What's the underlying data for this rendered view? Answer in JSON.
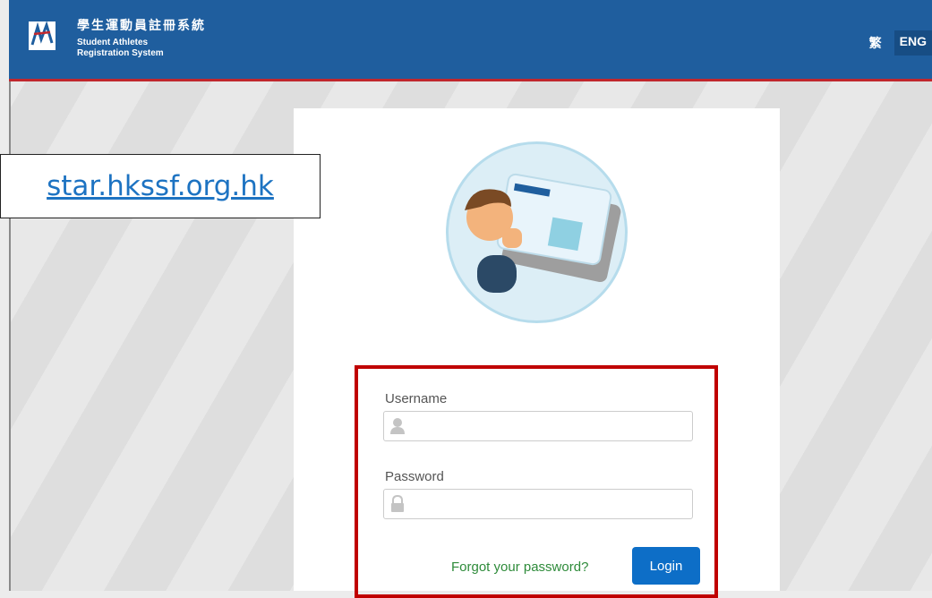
{
  "header": {
    "title_zh": "學生運動員註冊系統",
    "title_en_line1": "Student Athletes",
    "title_en_line2": "Registration System",
    "lang_zh": "繁",
    "lang_en": "ENG"
  },
  "overlay": {
    "url": "star.hkssf.org.hk"
  },
  "login": {
    "username_label": "Username",
    "password_label": "Password",
    "forgot_label": "Forgot your password?",
    "login_label": "Login"
  },
  "icons": {
    "logo": "star-logo-icon",
    "avatar": "user-id-card-icon",
    "user": "user-icon",
    "lock": "lock-icon"
  },
  "colors": {
    "header": "#1f5e9e",
    "accent_red": "#c00000",
    "button": "#0d6ec7",
    "link_green": "#2e8b3a",
    "url_blue": "#1d73c2"
  }
}
